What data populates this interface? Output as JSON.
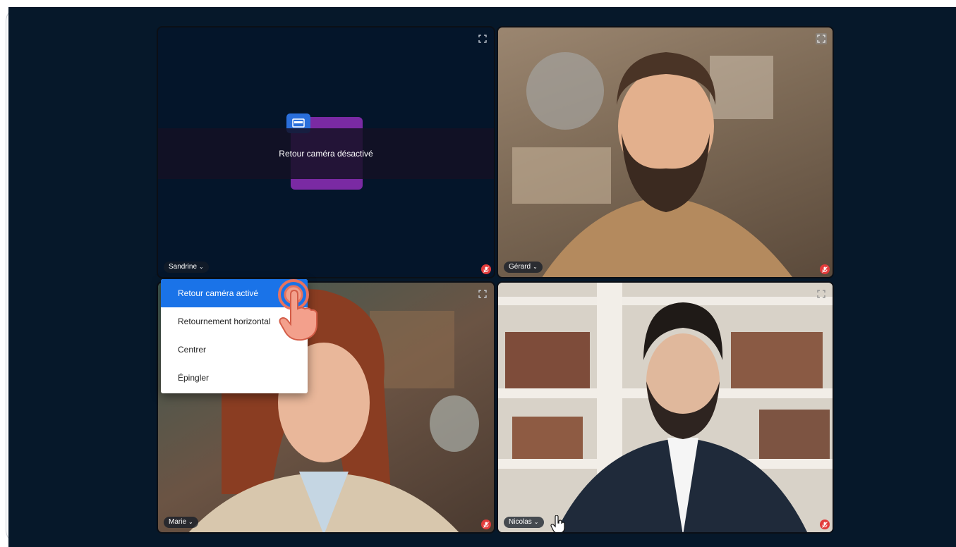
{
  "tiles": [
    {
      "name": "Sandrine",
      "banner": "Retour caméra désactivé",
      "camera_off": true
    },
    {
      "name": "Gérard"
    },
    {
      "name": "Marie"
    },
    {
      "name": "Nicolas"
    }
  ],
  "menu": {
    "items": [
      {
        "label": "Retour caméra activé",
        "active": true
      },
      {
        "label": "Retournement horizontal"
      },
      {
        "label": "Centrer"
      },
      {
        "label": "Épingler"
      }
    ]
  },
  "icons": {
    "expand": "expand-icon",
    "mute": "mic-muted-icon",
    "pointer": "hand-pointer-icon",
    "tap": "tap-gesture-icon"
  },
  "colors": {
    "background": "#06182a",
    "menu_active": "#1a73e8",
    "mute_badge": "#e23b3b",
    "banner_card": "#7a2aa3"
  }
}
